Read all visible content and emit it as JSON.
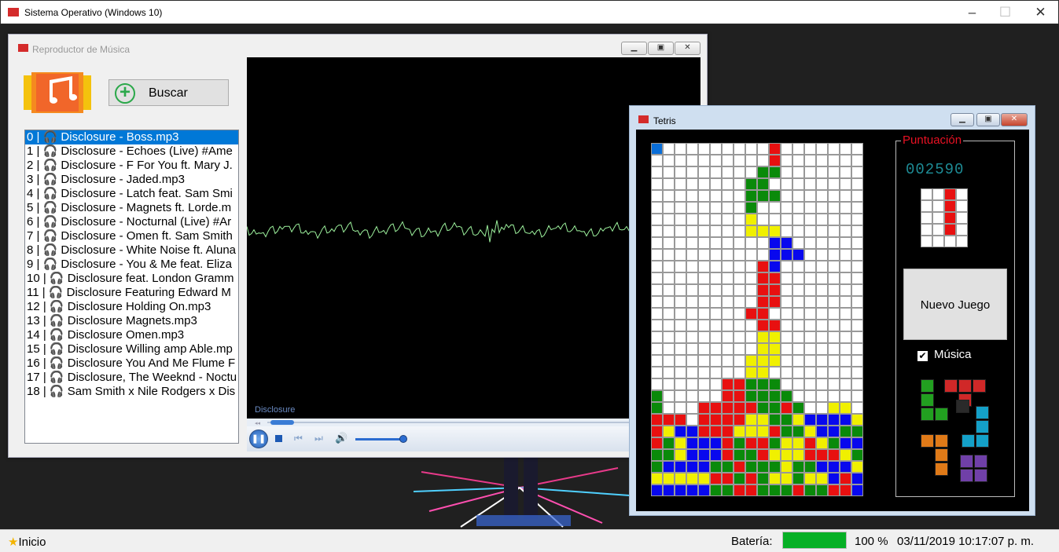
{
  "os_window": {
    "title": "Sistema Operativo (Windows 10)"
  },
  "music_window": {
    "title": "Reproductor de Música",
    "search_label": "Buscar",
    "playlist": [
      "0 | 🎧 Disclosure - Boss.mp3",
      "1 | 🎧 Disclosure - Echoes (Live)  #Ame",
      "2 | 🎧 Disclosure - F For You ft. Mary J.",
      "3 | 🎧 Disclosure - Jaded.mp3",
      "4 | 🎧 Disclosure - Latch feat. Sam Smi",
      "5 | 🎧 Disclosure - Magnets ft. Lorde.m",
      "6 | 🎧 Disclosure - Nocturnal (Live)  #Ar",
      "7 | 🎧 Disclosure - Omen ft. Sam Smith",
      "8 | 🎧 Disclosure - White Noise ft. Aluna",
      "9 | 🎧 Disclosure - You & Me  feat. Eliza",
      "10 | 🎧 Disclosure feat. London Gramm",
      "11 | 🎧 Disclosure Featuring Edward M",
      "12 | 🎧 Disclosure Holding On.mp3",
      "13 | 🎧 Disclosure Magnets.mp3",
      "14 | 🎧 Disclosure Omen.mp3",
      "15 | 🎧 Disclosure Willing amp Able.mp",
      "16 | 🎧 Disclosure You And Me Flume F",
      "17 | 🎧 Disclosure, The Weeknd - Noctu",
      "18 | 🎧 Sam Smith x Nile Rodgers x Dis"
    ],
    "selected_index": 0,
    "now_playing": "Disclosure",
    "accent": "#0078d7",
    "waveform_color": "#9cf09c"
  },
  "tetris_window": {
    "title": "Tetris",
    "score_title": "Puntuación",
    "score": "002590",
    "new_game_label": "Nuevo Juego",
    "music_label": "Música",
    "music_checked": true,
    "colors": {
      "R": "#e81010",
      "G": "#0a8a0a",
      "B": "#0808ee",
      "Y": "#f0f000",
      "L": "#0a6ed8",
      "W": "#ffffff"
    },
    "board": [
      "L.........R.......",
      "..........R.......",
      ".........GG.......",
      "........GG........",
      "........GGG.......",
      "........G.........",
      "........Y.........",
      "........YYY.......",
      "..........BB......",
      "..........BBB.....",
      ".........RB.......",
      ".........RR.......",
      ".........RR.......",
      ".........RR.......",
      "........RR........",
      ".........RR.......",
      ".........YY.......",
      ".........YY.......",
      "........YYY.......",
      "........YY........",
      "......RRGGG.......",
      "G.....RRGGGG......",
      "G...RRRRRGGRG..YY.",
      "RRR.RRRRYYGGYBBBBY",
      "RYBBRRRYYYRGGYBBGG",
      "RGYBBBRGRRGYYRYGBB",
      "GGYBBBRGGRYYYRRRYG",
      "GBBBBGGRGGGYGGBBBY",
      "YYYYYRRGRGYYGYYBRB",
      "BBBBBGGRRGGGRGGRRB"
    ],
    "next_piece": [
      "..R.",
      "..R.",
      "..R.",
      "..R.",
      "...."
    ]
  },
  "taskbar": {
    "start_label": "Inicio",
    "battery_label": "Batería:",
    "battery_value": 1.0,
    "battery_pct": "100 %",
    "datetime": "03/11/2019 10:17:07 p. m."
  }
}
